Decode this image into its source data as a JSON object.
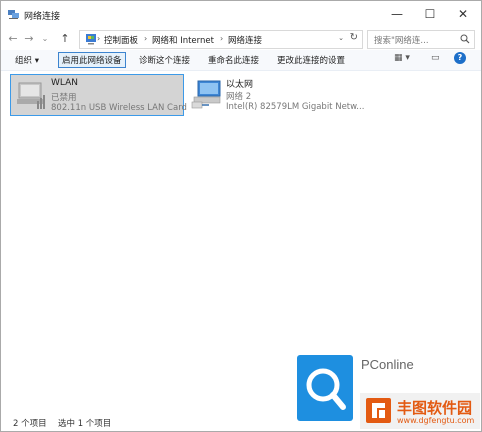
{
  "window": {
    "title": "网络连接",
    "minimize": "—",
    "maximize": "☐",
    "close": "✕"
  },
  "address": {
    "back": "←",
    "forward": "→",
    "dropdown": "⌄",
    "up": "↑",
    "crumbs": [
      "控制面板",
      "网络和 Internet",
      "网络连接"
    ],
    "separator": "›",
    "refresh": "↻",
    "search_placeholder": "搜索\"网络连..."
  },
  "commands": {
    "organize": "组织 ▾",
    "disable": "启用此网络设备",
    "diagnose": "诊断这个连接",
    "rename": "重命名此连接",
    "change_settings": "更改此连接的设置",
    "view": "▦ ▾",
    "pane": "▭",
    "help": "?"
  },
  "connections": [
    {
      "name": "WLAN",
      "status": "已禁用",
      "device": "802.11n USB Wireless LAN Card",
      "selected": true
    },
    {
      "name": "以太网",
      "status": "网络 2",
      "device": "Intel(R) 82579LM Gigabit Netw...",
      "selected": false
    }
  ],
  "status": {
    "count": "2 个项目",
    "selected": "选中 1 个项目"
  },
  "watermark": {
    "brand": "PConline",
    "site": "丰图软件园",
    "url": "www.dgfengtu.com"
  },
  "colors": {
    "accent": "#3c84cf",
    "selected_bg": "#d4d4d4",
    "watermark_blue": "#1e8fe0",
    "watermark_orange": "#e35a12"
  }
}
